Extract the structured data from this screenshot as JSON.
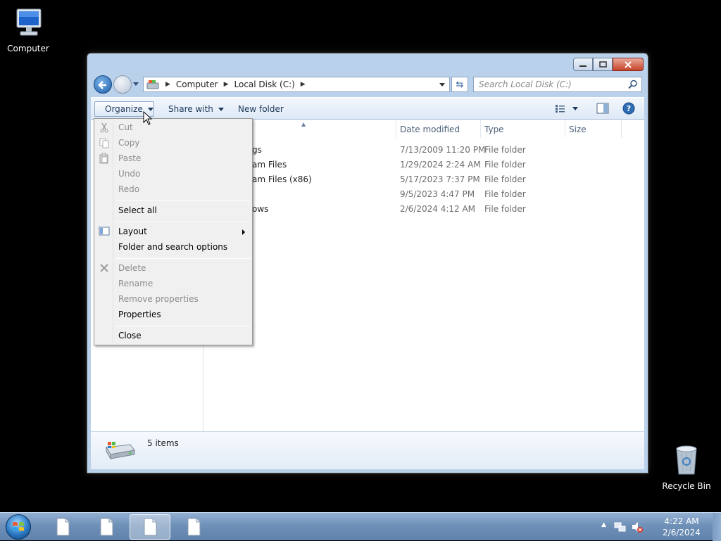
{
  "desktop": {
    "icons": [
      {
        "label": "Computer"
      },
      {
        "label": "Recycle Bin"
      }
    ]
  },
  "window": {
    "address": {
      "crumbs": [
        "Computer",
        "Local Disk (C:)"
      ]
    },
    "search": {
      "placeholder": "Search Local Disk (C:)"
    },
    "toolbar": {
      "organize_label": "Organize",
      "share_label": "Share with",
      "new_folder_label": "New folder",
      "view_icon": "views-icon",
      "preview_icon": "preview-pane-icon",
      "help_icon": "help-icon"
    },
    "columns": [
      "Date modified",
      "Type",
      "Size"
    ],
    "files": [
      {
        "name_fragment": "gs",
        "date": "7/13/2009 11:20 PM",
        "type": "File folder"
      },
      {
        "name_fragment": "am Files",
        "date": "1/29/2024 2:24 AM",
        "type": "File folder"
      },
      {
        "name_fragment": "am Files (x86)",
        "date": "5/17/2023 7:37 PM",
        "type": "File folder"
      },
      {
        "name_fragment": "",
        "date": "9/5/2023 4:47 PM",
        "type": "File folder"
      },
      {
        "name_fragment": "ows",
        "date": "2/6/2024 4:12 AM",
        "type": "File folder"
      }
    ],
    "details": {
      "count": "5 items"
    }
  },
  "menu": {
    "items": [
      {
        "label": "Cut",
        "enabled": false
      },
      {
        "label": "Copy",
        "enabled": false
      },
      {
        "label": "Paste",
        "enabled": false
      },
      {
        "label": "Undo",
        "enabled": false
      },
      {
        "label": "Redo",
        "enabled": false
      },
      {
        "label": "Select all",
        "enabled": true
      },
      {
        "label": "Layout",
        "enabled": true
      },
      {
        "label": "Folder and search options",
        "enabled": true
      },
      {
        "label": "Delete",
        "enabled": false
      },
      {
        "label": "Rename",
        "enabled": false
      },
      {
        "label": "Remove properties",
        "enabled": false
      },
      {
        "label": "Properties",
        "enabled": true
      },
      {
        "label": "Close",
        "enabled": true
      }
    ]
  },
  "taskbar": {
    "time": "4:22 AM",
    "date": "2/6/2024"
  },
  "colors": {
    "desktop": "#000000",
    "taskbar": "#6f90b7",
    "window_frame": "#b9d1ea",
    "close_button": "#c7432a"
  }
}
